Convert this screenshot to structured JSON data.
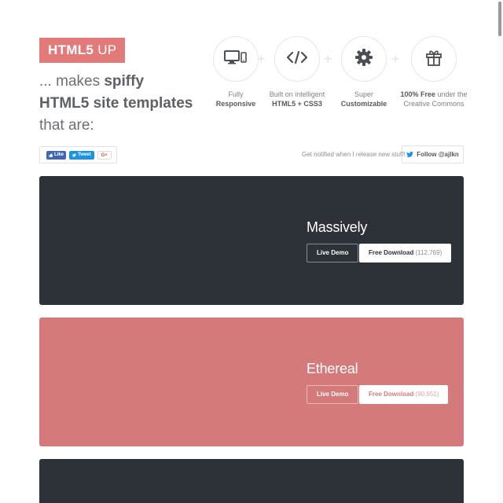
{
  "header": {
    "logo_bold": "HTML5",
    "logo_light": " UP",
    "tagline_prefix": "... makes ",
    "tagline_bold": "spiffy HTML5 site templates",
    "tagline_suffix": " that are:"
  },
  "features": [
    {
      "icon": "devices-icon",
      "line1": "Fully",
      "line2": "Responsive"
    },
    {
      "icon": "code-icon",
      "line1": "Built on intelligent",
      "line2": "HTML5 + CSS3"
    },
    {
      "icon": "gear-icon",
      "line1": "Super",
      "line2": "Customizable"
    },
    {
      "icon": "gift-icon",
      "line1_bold": "100% Free",
      "line1_rest": " under the",
      "line2": "Creative Commons"
    }
  ],
  "social": {
    "like_label": "Like",
    "tweet_label": "Tweet",
    "gplus_label": "G+",
    "notify_text": "Get notified when I release new stuff!",
    "follow_label": "Follow @ajlkn"
  },
  "templates": [
    {
      "name": "Massively",
      "demo_label": "Live Demo",
      "download_label": "Free Download",
      "download_count": "(112,769)",
      "color": "#2d3138"
    },
    {
      "name": "Ethereal",
      "demo_label": "Live Demo",
      "download_label": "Free Download",
      "download_count": "(90,951)",
      "color": "#d57a7a"
    },
    {
      "name": "",
      "color": "#2d3138"
    }
  ],
  "colors": {
    "accent": "#e37a7a",
    "dark_card": "#2d3138",
    "red_card": "#d57a7a"
  }
}
